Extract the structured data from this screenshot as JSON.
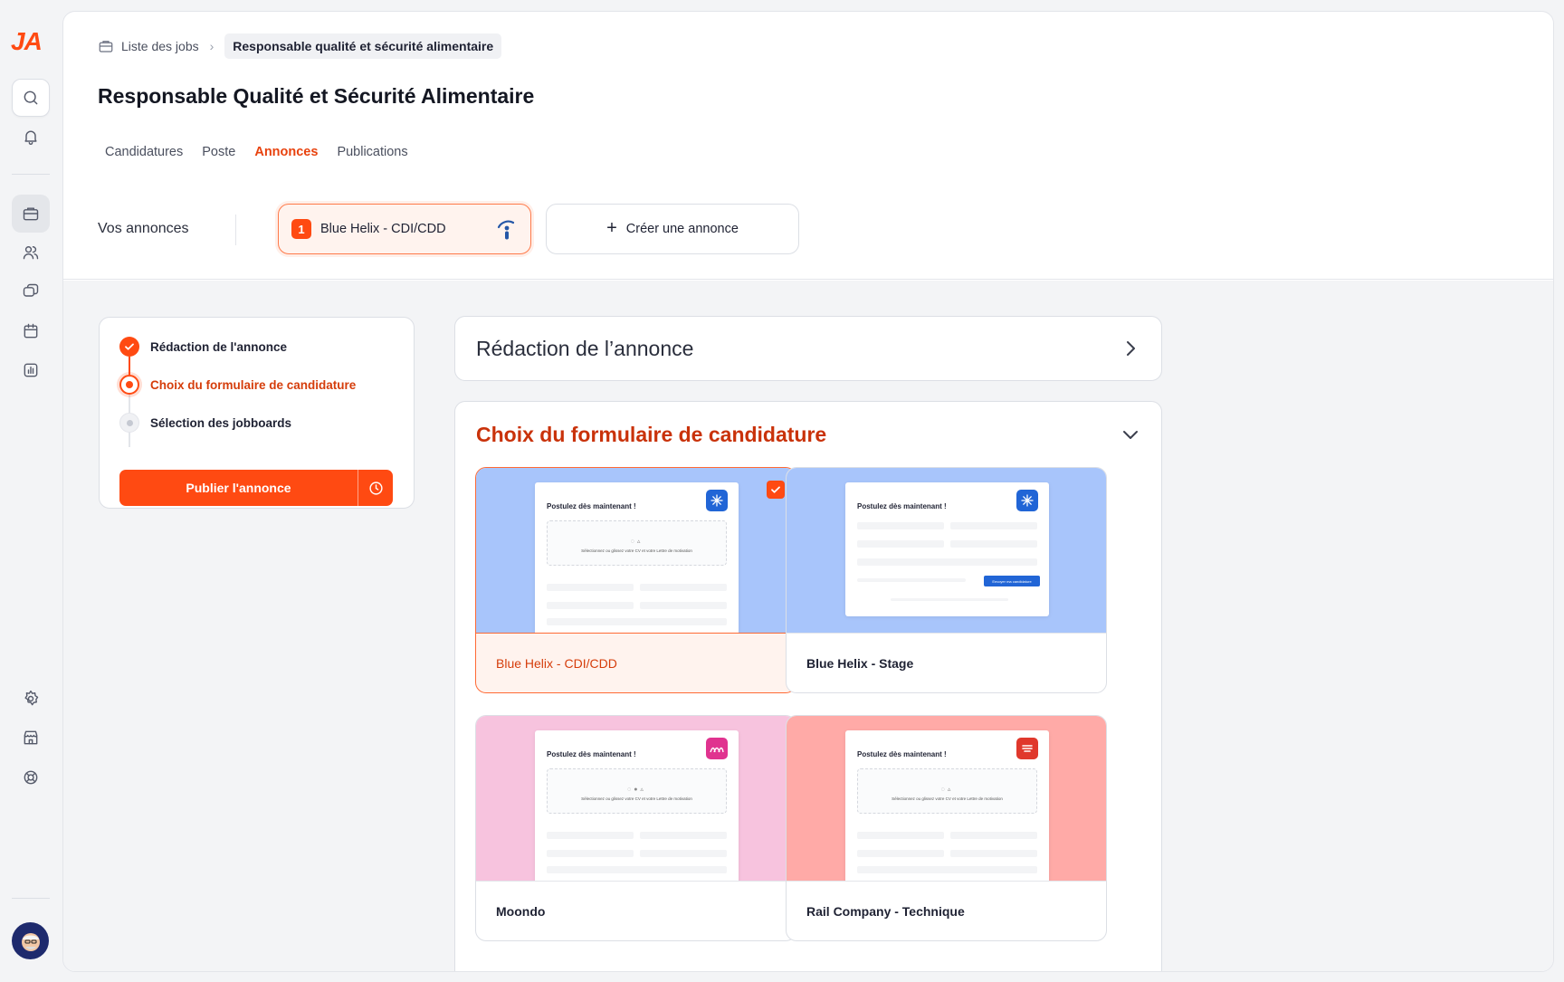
{
  "brand": {
    "logo_text": "JA",
    "accent": "#ff4a12"
  },
  "sidebar": {
    "items": [
      {
        "icon": "search-icon"
      },
      {
        "icon": "bell-icon"
      },
      {
        "icon": "briefcase-icon",
        "active": true
      },
      {
        "icon": "users-icon"
      },
      {
        "icon": "chat-icon"
      },
      {
        "icon": "calendar-icon"
      },
      {
        "icon": "chart-icon"
      },
      {
        "icon": "gear-icon"
      },
      {
        "icon": "store-icon"
      },
      {
        "icon": "lifebuoy-icon"
      }
    ]
  },
  "breadcrumb": {
    "parent": "Liste des jobs",
    "current": "Responsable qualité et sécurité alimentaire"
  },
  "page": {
    "title": "Responsable Qualité et Sécurité Alimentaire"
  },
  "tabs": [
    {
      "label": "Candidatures"
    },
    {
      "label": "Poste"
    },
    {
      "label": "Annonces",
      "active": true
    },
    {
      "label": "Publications"
    }
  ],
  "annonces": {
    "label": "Vos annonces",
    "chip": {
      "number": "1",
      "label": "Blue Helix - CDI/CDD"
    },
    "create_label": "Créer une annonce"
  },
  "stepper": {
    "steps": [
      {
        "label": "Rédaction de l'annonce",
        "state": "done"
      },
      {
        "label": "Choix du formulaire de candidature",
        "state": "current"
      },
      {
        "label": "Sélection des jobboards",
        "state": "todo"
      }
    ],
    "publish_label": "Publier l'annonce"
  },
  "sections": {
    "redaction_title": "Rédaction de l’annonce",
    "choix_title": "Choix du formulaire de candidature"
  },
  "forms": [
    {
      "label": "Blue Helix - CDI/CDD",
      "selected": true,
      "bg": "#a8c5fb",
      "logo_color": "#2165d6",
      "preview_title": "Postulez dès maintenant !",
      "drop_text": "Sélectionnez ou glissez votre CV et votre Lettre de motivation"
    },
    {
      "label": "Blue Helix - Stage",
      "selected": false,
      "bg": "#a8c5fb",
      "logo_color": "#2165d6",
      "preview_title": "Postulez dès maintenant !",
      "button_text": "Envoyer ma candidature"
    },
    {
      "label": "Moondo",
      "selected": false,
      "bg": "#f7c3de",
      "logo_color": "#e0338f",
      "preview_title": "Postulez dès maintenant !",
      "drop_text": "Sélectionnez ou glissez votre CV et votre Lettre de motivation"
    },
    {
      "label": "Rail Company - Technique",
      "selected": false,
      "bg": "#ffaaa7",
      "logo_color": "#e0382c",
      "preview_title": "Postulez dès maintenant !",
      "drop_text": "Sélectionnez ou glissez votre CV et votre Lettre de motivation"
    }
  ]
}
